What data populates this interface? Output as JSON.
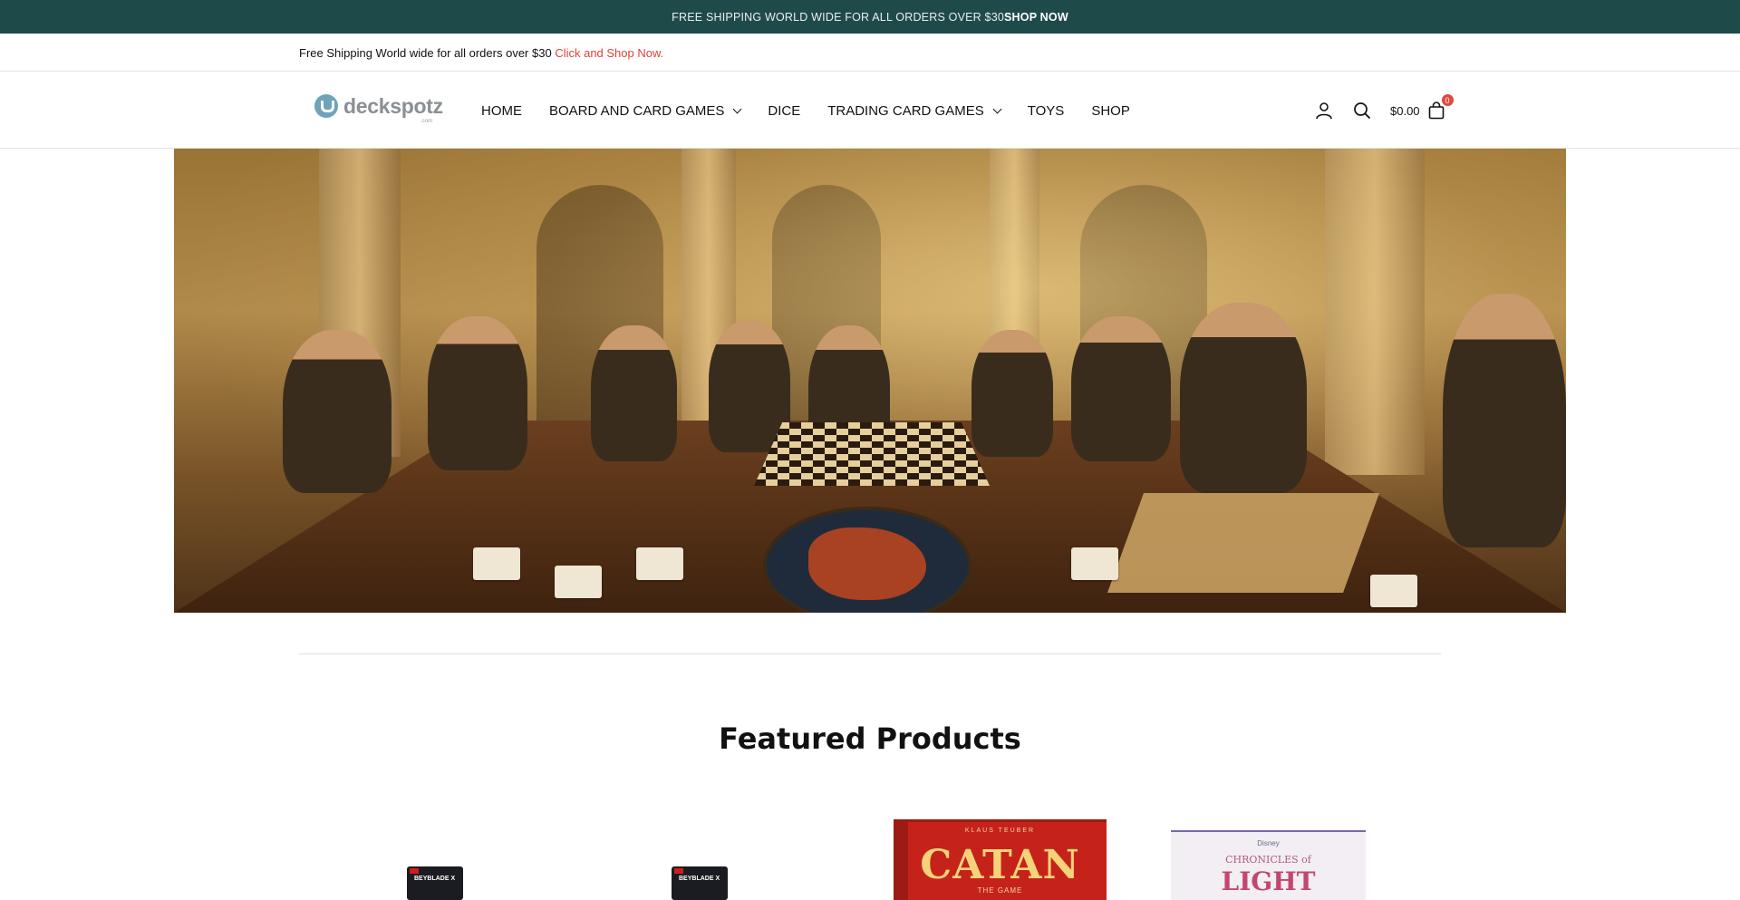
{
  "announcement": {
    "text": "FREE SHIPPING WORLD WIDE FOR ALL ORDERS OVER $30",
    "cta": "SHOP NOW"
  },
  "infobar": {
    "text": "Free Shipping World wide for all orders over $30",
    "link": "Click and Shop Now."
  },
  "header": {
    "logo_text": "deckspotz",
    "logo_sub": ".com",
    "nav": [
      {
        "label": "HOME",
        "has_dropdown": false
      },
      {
        "label": "BOARD AND CARD GAMES",
        "has_dropdown": true
      },
      {
        "label": "DICE",
        "has_dropdown": false
      },
      {
        "label": "TRADING CARD GAMES",
        "has_dropdown": true
      },
      {
        "label": "TOYS",
        "has_dropdown": false
      },
      {
        "label": "SHOP",
        "has_dropdown": false
      }
    ],
    "icons": [
      "account-icon",
      "search-icon",
      "cart-icon"
    ],
    "cart_total": "$0.00",
    "cart_count": "0"
  },
  "section": {
    "title": "Featured Products"
  },
  "products": [
    {
      "box_text": "BEYBLADE X"
    },
    {
      "box_text": "BEYBLADE X"
    },
    {
      "box_top": "KLAUS TEUBER",
      "box_title": "CATAN",
      "box_sub": "THE GAME"
    },
    {
      "box_brand": "Disney",
      "box_title_1": "CHRONICLES of",
      "box_title_2": "LIGHT"
    }
  ],
  "colors": {
    "announcement_bg": "#1f4a4a",
    "link_red": "#d9443a",
    "badge_red": "#e2473d"
  }
}
